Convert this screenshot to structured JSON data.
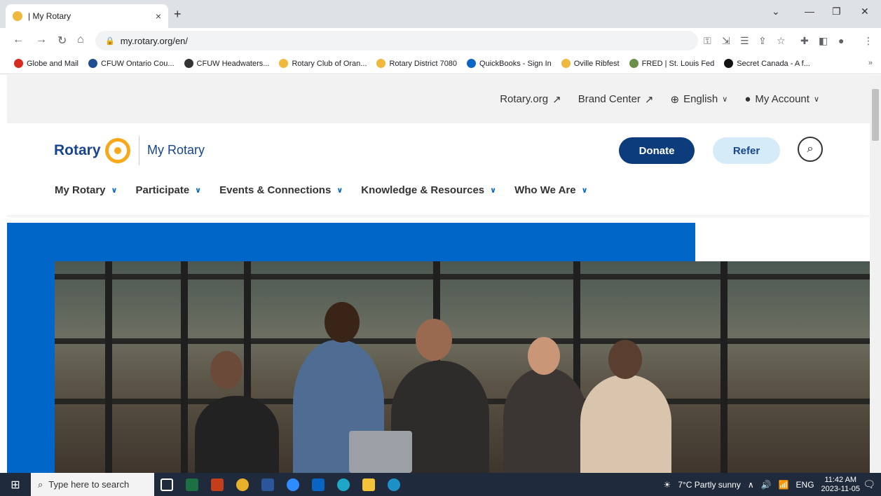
{
  "browser": {
    "tab_title": "| My Rotary",
    "tab_close": "×",
    "new_tab": "+",
    "url": "my.rotary.org/en/",
    "bookmarks": [
      {
        "label": "Globe and Mail",
        "color": "#d62c1f"
      },
      {
        "label": "CFUW Ontario Cou...",
        "color": "#1d4f91"
      },
      {
        "label": "CFUW Headwaters...",
        "color": "#333333"
      },
      {
        "label": "Rotary Club of Oran...",
        "color": "#f0b83c"
      },
      {
        "label": "Rotary District 7080",
        "color": "#f0b83c"
      },
      {
        "label": "QuickBooks - Sign In",
        "color": "#0a66c2"
      },
      {
        "label": "Oville Ribfest",
        "color": "#f0b83c"
      },
      {
        "label": "FRED | St. Louis Fed",
        "color": "#6c8f4a"
      },
      {
        "label": "Secret Canada - A f...",
        "color": "#111111"
      }
    ],
    "bookmarks_more": "»"
  },
  "utility_nav": {
    "items": [
      {
        "label": "Rotary.org",
        "icon": "external-link-icon"
      },
      {
        "label": "Brand Center",
        "icon": "external-link-icon"
      },
      {
        "label": "English",
        "icon": "globe-icon"
      },
      {
        "label": "My Account",
        "icon": "user-icon"
      }
    ]
  },
  "header": {
    "logo_text": "Rotary",
    "site_name": "My Rotary",
    "donate_label": "Donate",
    "refer_label": "Refer",
    "brand_blue": "#17458f",
    "accent_gold": "#f7a81b"
  },
  "main_nav": [
    {
      "label": "My Rotary"
    },
    {
      "label": "Participate"
    },
    {
      "label": "Events & Connections"
    },
    {
      "label": "Knowledge & Resources"
    },
    {
      "label": "Who We Are"
    }
  ],
  "taskbar": {
    "search_placeholder": "Type here to search",
    "weather": "7°C  Partly sunny",
    "language": "ENG",
    "time": "11:42 AM",
    "date": "2023-11-05"
  }
}
